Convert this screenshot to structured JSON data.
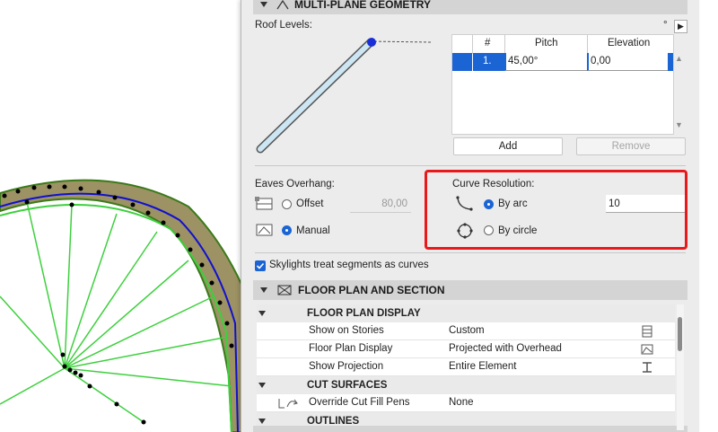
{
  "panel": {
    "multiplane_header": "MULTI-PLANE GEOMETRY",
    "roof_levels_label": "Roof Levels:",
    "degree_symbol": "°",
    "levels_table": {
      "headers": [
        "#",
        "Pitch",
        "Elevation"
      ],
      "rows": [
        {
          "num": "1.",
          "pitch": "45,00°",
          "elevation": "0,00"
        }
      ]
    },
    "add_button": "Add",
    "remove_button": "Remove",
    "eaves_label": "Eaves Overhang:",
    "offset_label": "Offset",
    "offset_value": "80,00",
    "manual_label": "Manual",
    "curve_label": "Curve Resolution:",
    "by_arc_label": "By arc",
    "by_arc_value": "10",
    "by_circle_label": "By circle",
    "skylights_label": "Skylights treat segments as curves",
    "floor_plan_header": "FLOOR PLAN AND SECTION",
    "floor_plan_display_header": "FLOOR PLAN DISPLAY",
    "fp_rows": [
      {
        "name": "Show on Stories",
        "value": "Custom"
      },
      {
        "name": "Floor Plan Display",
        "value": "Projected with Overhead"
      },
      {
        "name": "Show Projection",
        "value": "Entire Element"
      }
    ],
    "cut_surfaces_header": "CUT SURFACES",
    "cut_row": {
      "name": "Override Cut Fill Pens",
      "value": "None"
    },
    "outlines_header": "OUTLINES"
  },
  "colors": {
    "accent_blue": "#1a64d4",
    "highlight_red": "#e8191b",
    "roof_fill": "#9d9264",
    "plan_green": "#3dd03d"
  }
}
